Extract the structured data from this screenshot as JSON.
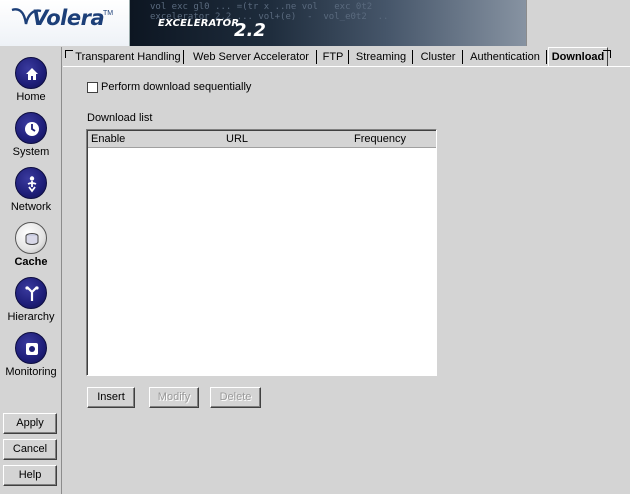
{
  "header": {
    "logo_text": "Volera",
    "logo_tm": "TM",
    "banner_code": "vol exc gl0 ... =(tr x ..ne vol   exc 0t2\nexcelerator_2.2 ... vol+(e)  -  vol_e0t2  ..\n",
    "product_name": "EXCELERATOR",
    "version": "2.2"
  },
  "sidebar": {
    "items": [
      {
        "label": "Home",
        "icon": "home-icon",
        "active": false
      },
      {
        "label": "System",
        "icon": "clock-icon",
        "active": false
      },
      {
        "label": "Network",
        "icon": "network-icon",
        "active": false
      },
      {
        "label": "Cache",
        "icon": "cache-icon",
        "active": true
      },
      {
        "label": "Hierarchy",
        "icon": "hierarchy-icon",
        "active": false
      },
      {
        "label": "Monitoring",
        "icon": "monitoring-icon",
        "active": false
      }
    ],
    "buttons": {
      "apply": "Apply",
      "cancel": "Cancel",
      "help": "Help"
    }
  },
  "tabs": [
    {
      "label": "Transparent Handling",
      "selected": false
    },
    {
      "label": "Web Server Accelerator",
      "selected": false
    },
    {
      "label": "FTP",
      "selected": false
    },
    {
      "label": "Streaming",
      "selected": false
    },
    {
      "label": "Cluster",
      "selected": false
    },
    {
      "label": "Authentication",
      "selected": false
    },
    {
      "label": "Download",
      "selected": true
    }
  ],
  "content": {
    "sequential_label": "Perform download sequentially",
    "sequential_checked": false,
    "list_title": "Download list",
    "columns": [
      "Enable",
      "URL",
      "Frequency"
    ],
    "rows": [],
    "buttons": {
      "insert": "Insert",
      "modify": "Modify",
      "delete": "Delete"
    }
  },
  "colors": {
    "accent": "#1c3f78",
    "nav_icon": "#1e1e78",
    "panel": "#d4d4d4"
  }
}
